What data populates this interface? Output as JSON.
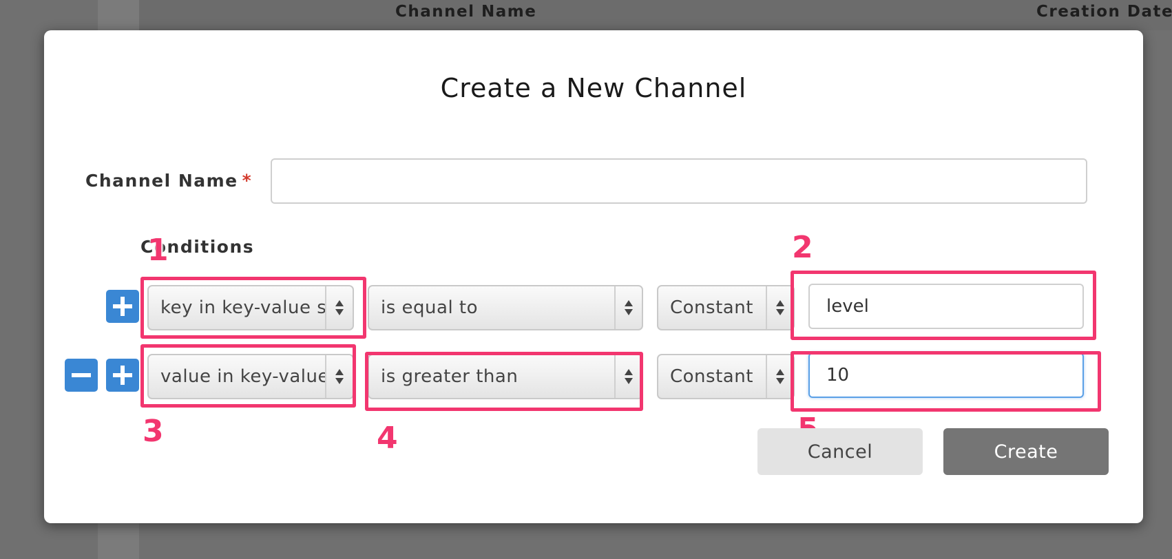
{
  "background": {
    "columns": [
      "Channel Name",
      "Creation Date"
    ]
  },
  "modal": {
    "title": "Create a New Channel",
    "channel_name_label": "Channel Name",
    "required_mark": "*",
    "channel_name_value": "",
    "conditions_label": "Conditions",
    "conditions": [
      {
        "field": "key in key-value s",
        "operator": "is equal to",
        "type": "Constant",
        "value": "level"
      },
      {
        "field": "value in key-value",
        "operator": "is greater than",
        "type": "Constant",
        "value": "10"
      }
    ],
    "cancel_label": "Cancel",
    "create_label": "Create"
  },
  "annotations": [
    "1",
    "2",
    "3",
    "4",
    "5"
  ],
  "colors": {
    "accent": "#3a87d4",
    "highlight": "#f2366f",
    "create_button": "#757575",
    "cancel_button": "#e3e3e3"
  }
}
